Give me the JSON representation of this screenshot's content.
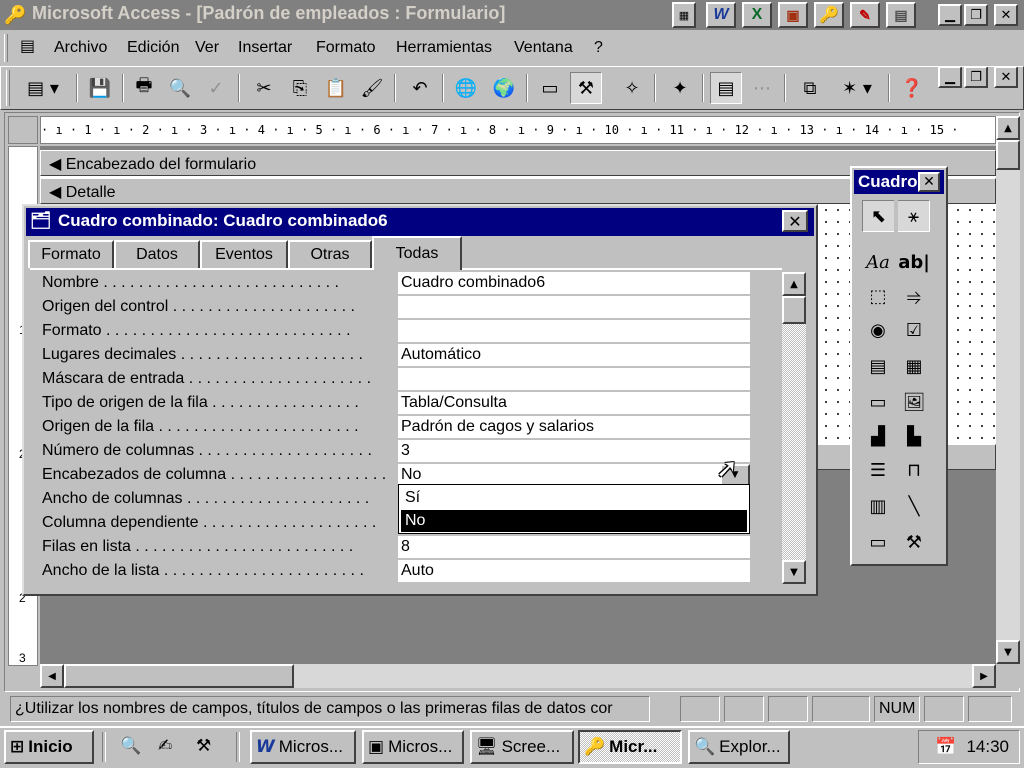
{
  "window": {
    "title": "Microsoft Access - [Padrón de empleados : Formulario]",
    "quick_icons": [
      "word-icon",
      "excel-icon",
      "powerpoint-icon",
      "access-icon",
      "schedule-icon",
      "bookshelf-icon"
    ],
    "quick_letters": [
      "W",
      "X"
    ]
  },
  "menu": {
    "items": [
      {
        "label": "Archivo"
      },
      {
        "label": "Edición"
      },
      {
        "label": "Ver"
      },
      {
        "label": "Insertar"
      },
      {
        "label": "Formato"
      },
      {
        "label": "Herramientas"
      },
      {
        "label": "Ventana"
      },
      {
        "label": "?"
      }
    ]
  },
  "toolbar": {
    "buttons": [
      "view",
      "save",
      "print",
      "print-preview",
      "spelling",
      "cut",
      "copy",
      "paste",
      "format-painter",
      "undo",
      "insert-hyperlink",
      "web-toolbar",
      "field-list",
      "toolbox",
      "autoformat",
      "code",
      "properties",
      "build",
      "database-window",
      "new-object",
      "office-assistant"
    ]
  },
  "ruler": {
    "text": "· ı · 1 · ı · 2 · ı · 3 · ı · 4 · ı · 5 · ı · 6 · ı · 7 · ı · 8 · ı · 9 · ı · 10 · ı · 11 · ı · 12 · ı · 13 · ı · 14 · ı · 15 ·",
    "vertical_marks": [
      "1",
      "2",
      "2",
      "3"
    ]
  },
  "sections": {
    "header": "Encabezado del formulario",
    "detail": "Detalle"
  },
  "property_sheet": {
    "title": "Cuadro combinado: Cuadro combinado6",
    "tabs": [
      {
        "label": "Formato"
      },
      {
        "label": "Datos"
      },
      {
        "label": "Eventos"
      },
      {
        "label": "Otras"
      },
      {
        "label": "Todas"
      }
    ],
    "active_tab": "Todas",
    "rows": [
      {
        "label": "Nombre . . . . . . . . . . . . . . . . . . . . . . . . . . .",
        "value": "Cuadro combinado6"
      },
      {
        "label": "Origen del control . . . . . . . . . . . . . . . . . . . . .",
        "value": ""
      },
      {
        "label": "Formato . . . . . . . . . . . . . . . . . . . . . . . . . . . .",
        "value": ""
      },
      {
        "label": "Lugares decimales . . . . . . . . . . . . . . . . . . . . .",
        "value": "Automático"
      },
      {
        "label": "Máscara de entrada . . . . . . . . . . . . . . . . . . . . .",
        "value": ""
      },
      {
        "label": "Tipo de origen de la fila . . . . . . . . . . . . . . . . .",
        "value": "Tabla/Consulta"
      },
      {
        "label": "Origen de la fila . . . . . . . . . . . . . . . . . . . . . . .",
        "value": "Padrón de cagos y salarios"
      },
      {
        "label": "Número de columnas . . . . . . . . . . . . . . . . . . . .",
        "value": "3"
      },
      {
        "label": "Encabezados de columna . . . . . . . . . . . . . . . . . .",
        "value": "No"
      },
      {
        "label": "Ancho de columnas . . . . . . . . . . . . . . . . . . . . .",
        "value": ""
      },
      {
        "label": "Columna dependiente . . . . . . . . . . . . . . . . . . . .",
        "value": ""
      },
      {
        "label": "Filas en lista . . . . . . . . . . . . . . . . . . . . . . . . .",
        "value": "8"
      },
      {
        "label": "Ancho de la lista . . . . . . . . . . . . . . . . . . . . . . .",
        "value": "Auto"
      }
    ],
    "dropdown": {
      "options": [
        "Sí",
        "No"
      ],
      "selected": "No"
    }
  },
  "toolbox": {
    "title": "Cuadro",
    "tools": [
      "select-objects",
      "control-wizards",
      "label",
      "text-box",
      "option-group",
      "toggle-button",
      "option-button",
      "check-box",
      "combo-box",
      "list-box",
      "command-button",
      "image",
      "unbound-object-frame",
      "bound-object-frame",
      "page-break",
      "tab-control",
      "subform",
      "line",
      "rectangle",
      "more-controls"
    ],
    "text_labels": {
      "label_tool": "Aa",
      "textbox_tool": "ab|"
    }
  },
  "status": {
    "message": "¿Utilizar los nombres de campos, títulos de campos o las primeras filas de datos cor",
    "num": "NUM"
  },
  "taskbar": {
    "start": "Inicio",
    "tasks": [
      {
        "label": "Micros..."
      },
      {
        "label": "Micros..."
      },
      {
        "label": "Scree..."
      },
      {
        "label": "Micr..."
      },
      {
        "label": "Explor..."
      }
    ],
    "clock": "14:30"
  }
}
